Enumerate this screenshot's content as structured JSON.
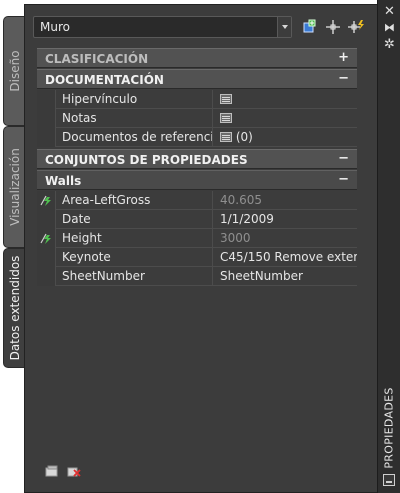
{
  "tabs": {
    "design": "Diseño",
    "display": "Visualización",
    "extended": "Datos extendidos"
  },
  "palette_title": "PROPIEDADES",
  "selector": {
    "value": "Muro"
  },
  "categories": {
    "classification": {
      "label": "CLASIFICACIÓN",
      "toggle": "+"
    },
    "documentation": {
      "label": "DOCUMENTACIÓN",
      "toggle": "−"
    },
    "property_sets": {
      "label": "CONJUNTOS DE PROPIEDADES",
      "toggle": "−"
    },
    "walls": {
      "label": "Walls",
      "toggle": "−"
    }
  },
  "documentation_rows": [
    {
      "name": "Hipervínculo",
      "value": ""
    },
    {
      "name": "Notas",
      "value": ""
    },
    {
      "name": "Documentos de referencia",
      "value": "(0)"
    }
  ],
  "walls_rows": [
    {
      "name": "Area-LeftGross",
      "value": "40.605"
    },
    {
      "name": "Date",
      "value": "1/1/2009"
    },
    {
      "name": "Height",
      "value": "3000"
    },
    {
      "name": "Keynote",
      "value": "C45/150 Remove exter..."
    },
    {
      "name": "SheetNumber",
      "value": "SheetNumber"
    }
  ],
  "icons": {
    "close": "close-icon",
    "autohide": "autohide-icon",
    "settings": "settings-icon",
    "add_selected": "add-selected-icon",
    "select_objects": "select-objects-icon",
    "quick_select": "quick-select-icon",
    "add_property_sets": "add-property-sets-icon",
    "remove_property_sets": "remove-property-sets-icon",
    "field": "field-icon",
    "automatic": "automatic-property-icon"
  }
}
